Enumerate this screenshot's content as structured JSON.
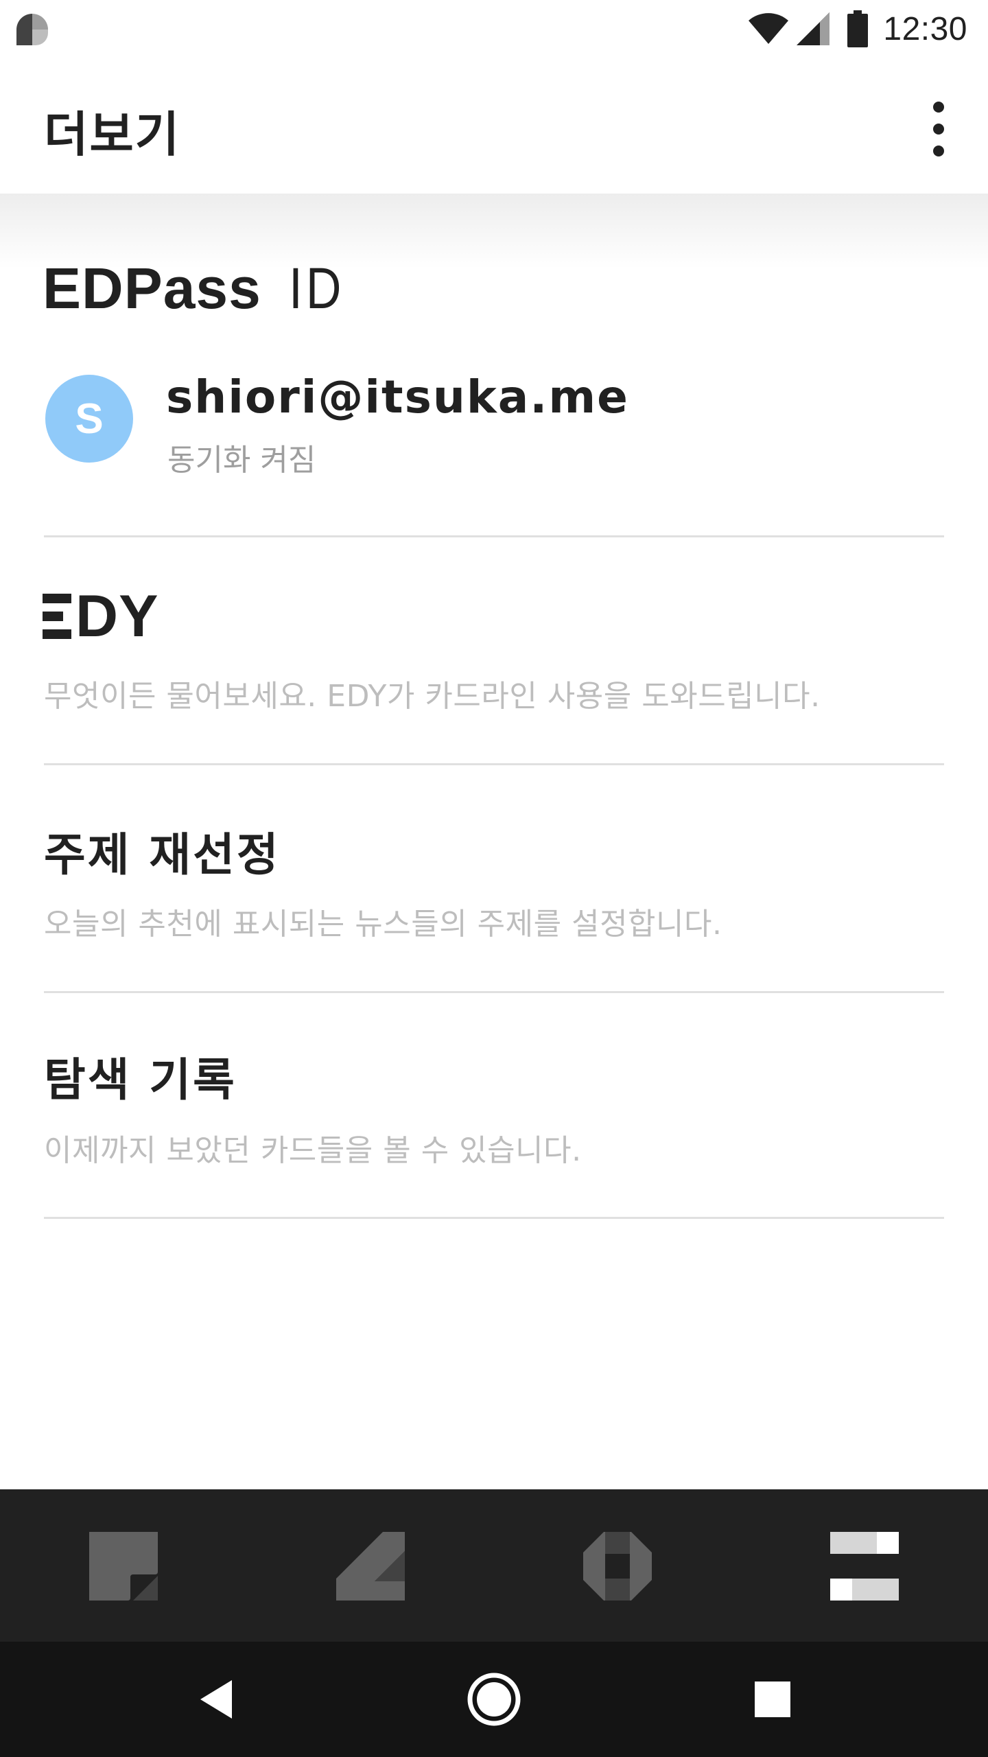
{
  "status_bar": {
    "time": "12:30",
    "icons": [
      "app-notification-icon",
      "wifi-icon",
      "cell-signal-icon",
      "battery-icon"
    ]
  },
  "app_bar": {
    "title": "더보기",
    "overflow_icon": "more-vert-icon"
  },
  "edpass": {
    "logo_word": "EDPass",
    "logo_suffix": "ID",
    "avatar_letter": "S",
    "avatar_color": "#90caf9",
    "email": "shiori@itsuka.me",
    "sync_status": "동기화 켜짐"
  },
  "menu": {
    "edy": {
      "logo_text": "DY",
      "description": "무엇이든 물어보세요. EDY가 카드라인 사용을 도와드립니다."
    },
    "topics": {
      "title": "주제 재선정",
      "description": "오늘의 추천에 표시되는 뉴스들의 주제를 설정합니다."
    },
    "history": {
      "title": "탐색 기록",
      "description": "이제까지 보았던 카드들을 볼 수 있습니다."
    }
  },
  "tab_bar": {
    "tabs": [
      "tab-home-icon",
      "tab-edit-icon",
      "tab-discover-icon",
      "tab-more-icon"
    ],
    "selected_index": 3,
    "background": "#212121"
  },
  "nav_bar": {
    "buttons": [
      "back-icon",
      "home-icon",
      "recents-icon"
    ]
  }
}
